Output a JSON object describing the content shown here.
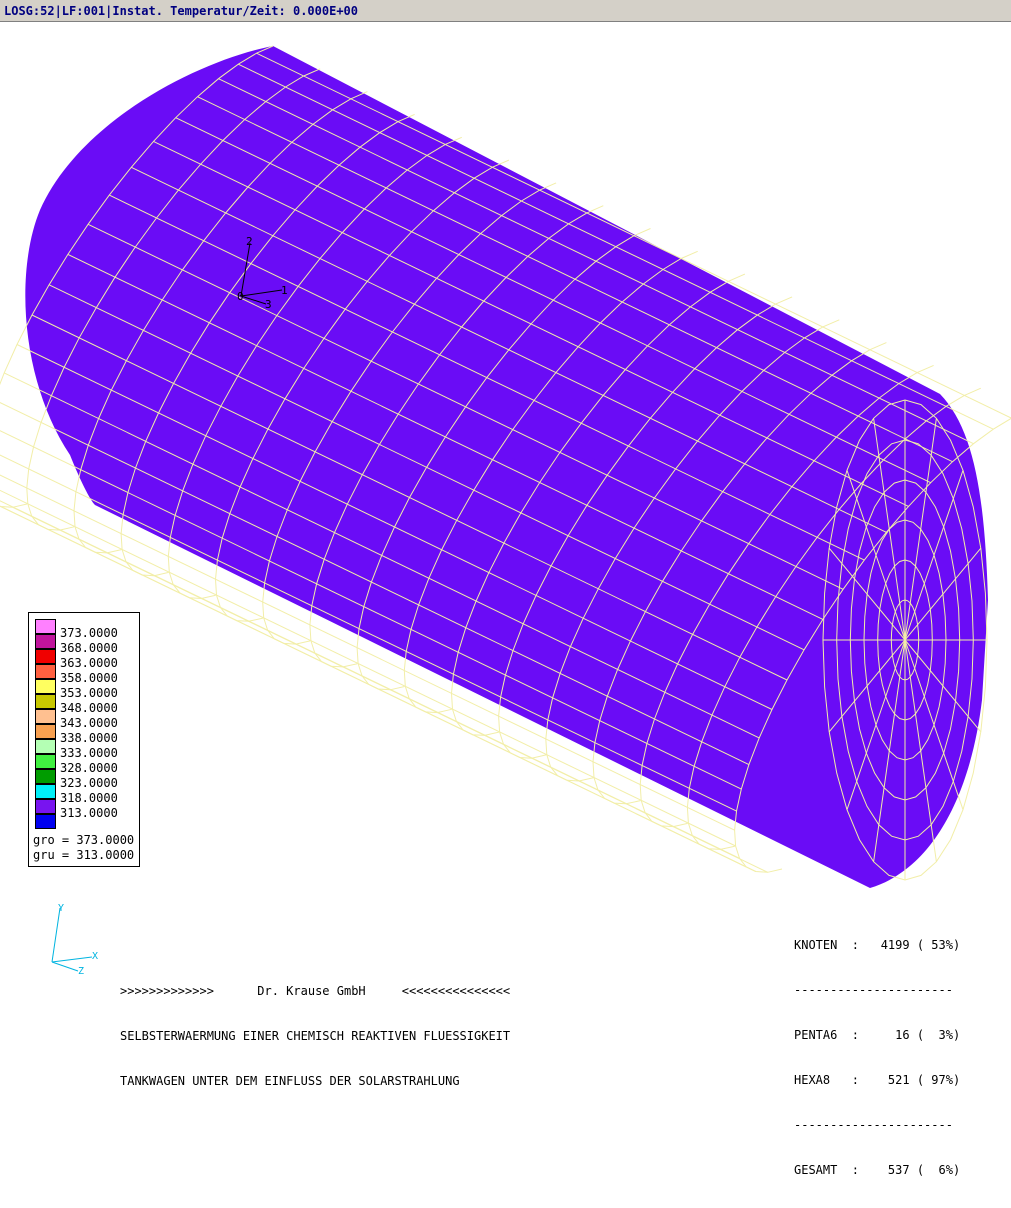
{
  "title_bar": {
    "text": "LOSG:52|LF:001|Instat. Temperatur/Zeit: 0.000E+00"
  },
  "colors": {
    "mesh_fill": "#6a0cf6",
    "mesh_line": "#f2eea8",
    "axis": "#00b4e0",
    "title_text": "#000080"
  },
  "local_axes": {
    "label_1": "1",
    "label_2": "2",
    "label_3": "3",
    "label_origin": "0"
  },
  "legend": {
    "entries": [
      {
        "value": "373.0000",
        "color": "#ff80ff"
      },
      {
        "value": "368.0000",
        "color": "#c0149c"
      },
      {
        "value": "363.0000",
        "color": "#f00000"
      },
      {
        "value": "358.0000",
        "color": "#ff6040"
      },
      {
        "value": "353.0000",
        "color": "#ffff60"
      },
      {
        "value": "348.0000",
        "color": "#c8c800"
      },
      {
        "value": "343.0000",
        "color": "#ffc090"
      },
      {
        "value": "338.0000",
        "color": "#f8a050"
      },
      {
        "value": "333.0000",
        "color": "#b4ffb4"
      },
      {
        "value": "328.0000",
        "color": "#40f040"
      },
      {
        "value": "323.0000",
        "color": "#009c00"
      },
      {
        "value": "318.0000",
        "color": "#00f0f8"
      },
      {
        "value": "313.0000",
        "color": "#7814f0"
      },
      {
        "value": "",
        "color": "#0000f0"
      }
    ],
    "gro": "gro = 373.0000",
    "gru": "gru = 313.0000"
  },
  "global_axes": {
    "y": "Y",
    "x": "X",
    "z": "Z"
  },
  "info": {
    "line1": ">>>>>>>>>>>>>      Dr. Krause GmbH     <<<<<<<<<<<<<<<",
    "line2": "SELBSTERWAERMUNG EINER CHEMISCH REAKTIVEN FLUESSIGKEIT",
    "line3": "TANKWAGEN UNTER DEM EINFLUSS DER SOLARSTRAHLUNG"
  },
  "stats": {
    "line1": "KNOTEN  :   4199 ( 53%)",
    "sep1": "----------------------",
    "line2": "PENTA6  :     16 (  3%)",
    "line3": "HEXA8   :    521 ( 97%)",
    "sep2": "----------------------",
    "line4": "GESAMT  :    537 (  6%)"
  }
}
